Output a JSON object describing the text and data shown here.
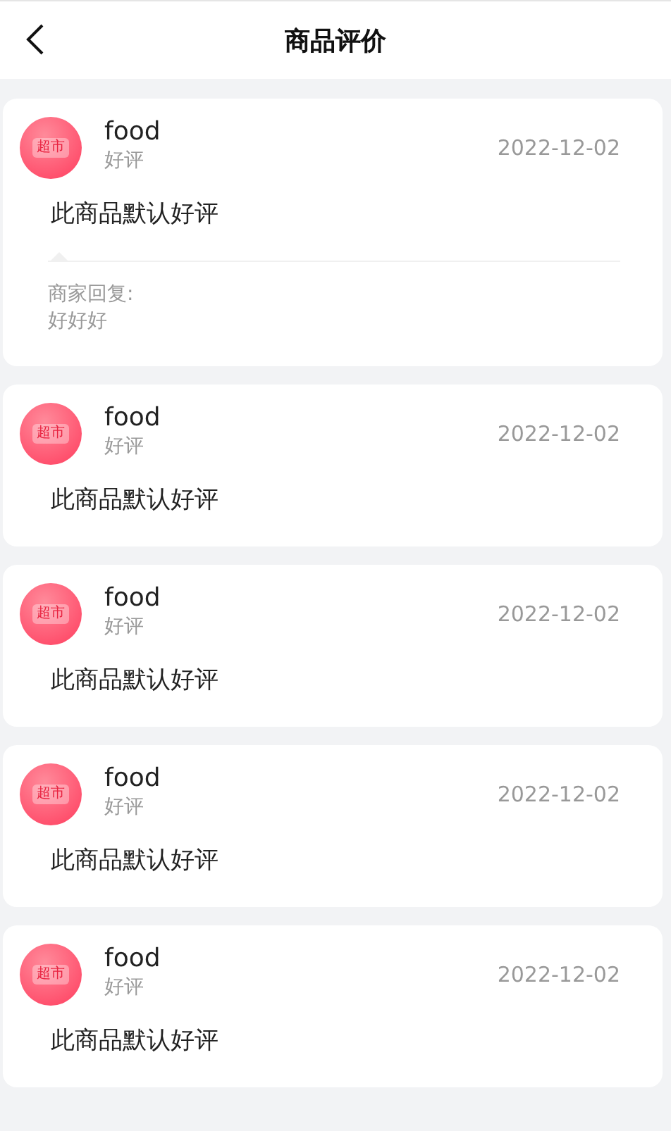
{
  "header": {
    "title": "商品评价"
  },
  "reviews": [
    {
      "avatar_label": "超市",
      "name": "food",
      "rating": "好评",
      "date": "2022-12-02",
      "text": "此商品默认好评",
      "reply": {
        "label": "商家回复:",
        "text": "好好好"
      }
    },
    {
      "avatar_label": "超市",
      "name": "food",
      "rating": "好评",
      "date": "2022-12-02",
      "text": "此商品默认好评"
    },
    {
      "avatar_label": "超市",
      "name": "food",
      "rating": "好评",
      "date": "2022-12-02",
      "text": "此商品默认好评"
    },
    {
      "avatar_label": "超市",
      "name": "food",
      "rating": "好评",
      "date": "2022-12-02",
      "text": "此商品默认好评"
    },
    {
      "avatar_label": "超市",
      "name": "food",
      "rating": "好评",
      "date": "2022-12-02",
      "text": "此商品默认好评"
    }
  ]
}
